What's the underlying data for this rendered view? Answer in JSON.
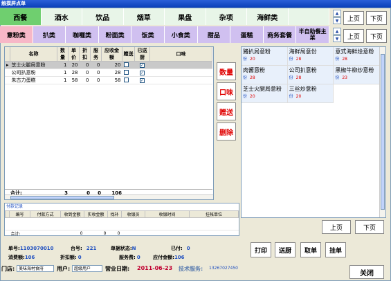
{
  "window": {
    "title": "触摸屏点单"
  },
  "categories": [
    "西餐",
    "酒水",
    "饮品",
    "烟草",
    "果盘",
    "杂项",
    "海鲜类",
    ""
  ],
  "subcategories": [
    "意粉类",
    "扒类",
    "咖喱类",
    "粉面类",
    "饭类",
    "小食类",
    "甜品",
    "蛋糕",
    "商务套餐",
    "半自助餐主菜"
  ],
  "top_pager": {
    "prev": "上页",
    "next": "下页"
  },
  "order": {
    "headers": [
      "名称",
      "数量",
      "单价",
      "折扣",
      "服务",
      "应收金额",
      "赠送",
      "已送厨",
      "口味"
    ],
    "rows": [
      {
        "name": "芝士火腿局意粉",
        "qty": "1",
        "price": "20",
        "discount": "0",
        "service": "0",
        "amount": "20",
        "gift": "",
        "sent": "✓",
        "taste": ""
      },
      {
        "name": "公司扒意粉",
        "qty": "1",
        "price": "28",
        "discount": "0",
        "service": "0",
        "amount": "28",
        "gift": "",
        "sent": "✓",
        "taste": ""
      },
      {
        "name": "朱古力蛋糕",
        "qty": "1",
        "price": "58",
        "discount": "0",
        "service": "0",
        "amount": "58",
        "gift": "",
        "sent": "✓",
        "taste": ""
      }
    ],
    "total": {
      "label": "合计:",
      "qty": "3",
      "discount": "0",
      "service": "0",
      "amount": "106"
    }
  },
  "side_buttons": [
    "数量",
    "口味",
    "赠送",
    "删除"
  ],
  "menu": [
    {
      "name": "猪扒局意粉",
      "tag": "份",
      "price": "20"
    },
    {
      "name": "海鲜局意份",
      "tag": "份",
      "price": "28"
    },
    {
      "name": "意式海鲜烩意粉",
      "tag": "份",
      "price": "28"
    },
    {
      "name": "肉酱意粉",
      "tag": "份",
      "price": "28"
    },
    {
      "name": "公司扒意粉",
      "tag": "份",
      "price": "28"
    },
    {
      "name": "黑椒牛柳炒意粉",
      "tag": "份",
      "price": "23"
    },
    {
      "name": "芝士火腿局意粉",
      "tag": "份",
      "price": "20"
    },
    {
      "name": "三丝炒意粉",
      "tag": "份",
      "price": "20"
    }
  ],
  "menu_pager": {
    "prev": "上页",
    "next": "下页"
  },
  "payment": {
    "label": "付款记录",
    "headers": [
      "编号",
      "付款方式",
      "收到金额",
      "实收金额",
      "找补",
      "收银员",
      "收银时间",
      "挂帐单位"
    ],
    "total": {
      "label": "合计:",
      "received": "0",
      "actual": "0",
      "change": "0"
    }
  },
  "info": {
    "order_no_label": "单号:",
    "order_no": "1103070010",
    "table_no_label": "台号:",
    "table_no": "221",
    "status_label": "单据状态:",
    "status": "N",
    "paid_label": "已付:",
    "paid": "0",
    "consume_label": "消费额:",
    "consume": "106",
    "discount_label": "折扣额:",
    "discount": "0",
    "service_label": "服务费:",
    "service": "0",
    "payable_label": "应付金额:",
    "payable": "106"
  },
  "actions": [
    "打印",
    "送厨",
    "取单",
    "挂单"
  ],
  "status_bar": {
    "store_label": "门店:",
    "store": "美味海村食府",
    "user_label": "用户:",
    "user": "超级用户",
    "date_label": "营业日期:",
    "date": "2011-06-23",
    "support_label": "技术服务:",
    "support": "13267027450",
    "close": "关闭"
  }
}
